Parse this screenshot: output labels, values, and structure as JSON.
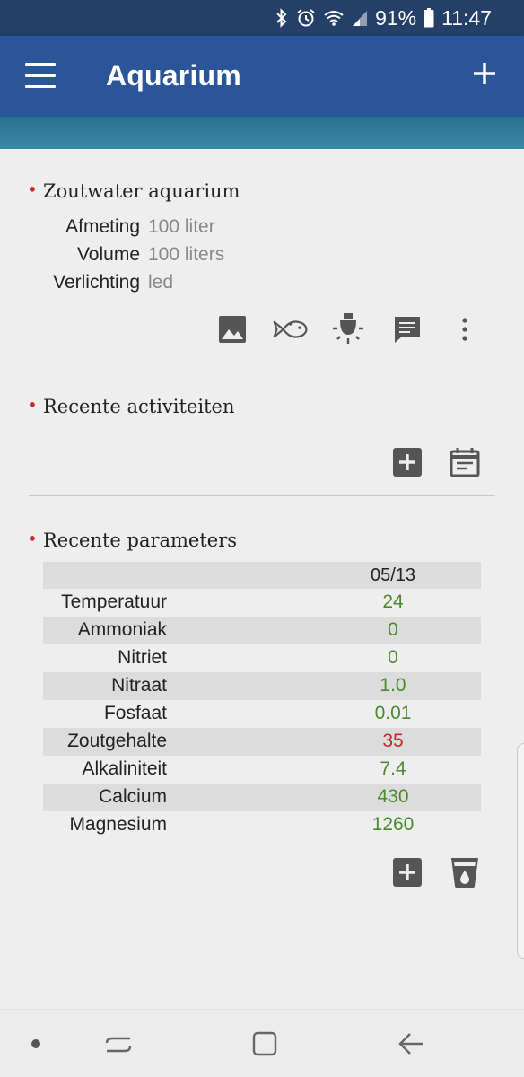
{
  "status_bar": {
    "battery": "91%",
    "time": "11:47"
  },
  "app_bar": {
    "title": "Aquarium"
  },
  "aquarium": {
    "title": "Zoutwater aquarium",
    "details": [
      {
        "label": "Afmeting",
        "value": "100 liter"
      },
      {
        "label": "Volume",
        "value": "100 liters"
      },
      {
        "label": "Verlichting",
        "value": "led"
      }
    ],
    "actions": [
      "image-icon",
      "fish-icon",
      "light-bulb-icon",
      "comment-icon",
      "more-vert-icon"
    ]
  },
  "activities": {
    "title": "Recente activiteiten",
    "actions": [
      "add-box-icon",
      "calendar-icon"
    ]
  },
  "parameters": {
    "title": "Recente parameters",
    "date": "05/13",
    "rows": [
      {
        "name": "Temperatuur",
        "value": "24",
        "status": "ok"
      },
      {
        "name": "Ammoniak",
        "value": "0",
        "status": "ok"
      },
      {
        "name": "Nitriet",
        "value": "0",
        "status": "ok"
      },
      {
        "name": "Nitraat",
        "value": "1.0",
        "status": "ok"
      },
      {
        "name": "Fosfaat",
        "value": "0.01",
        "status": "ok"
      },
      {
        "name": "Zoutgehalte",
        "value": "35",
        "status": "bad"
      },
      {
        "name": "Alkaliniteit",
        "value": "7.4",
        "status": "ok"
      },
      {
        "name": "Calcium",
        "value": "430",
        "status": "ok"
      },
      {
        "name": "Magnesium",
        "value": "1260",
        "status": "ok"
      }
    ],
    "actions": [
      "add-box-icon",
      "water-glass-icon"
    ]
  },
  "colors": {
    "status_bar": "#243f68",
    "app_bar": "#2a5598",
    "accent_bullet": "#c0302a",
    "value_ok": "#4a8a2a",
    "value_bad": "#c02a2a",
    "icon_gray": "#555555"
  }
}
